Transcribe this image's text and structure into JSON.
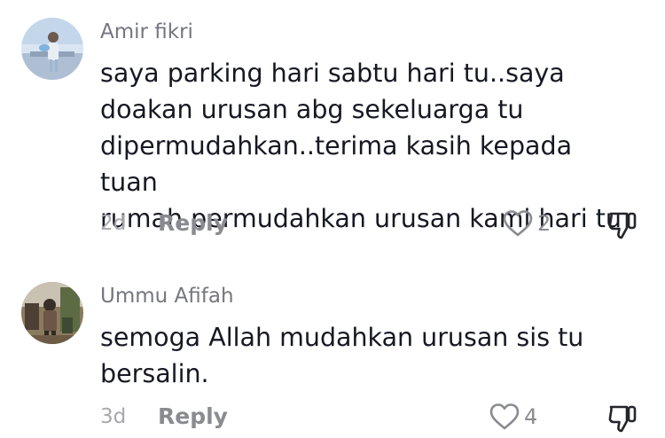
{
  "comments": [
    {
      "username": "Amir fikri",
      "lines": [
        "saya parking hari sabtu hari tu..saya",
        "doakan urusan abg sekeluarga tu",
        "dipermudahkan..terima kasih kepada tuan",
        "rumah permudahkan urusan kami hari tu"
      ],
      "time": "2d",
      "reply_label": "Reply",
      "likes": "2",
      "avatar_icon": "person-photo-avatar"
    },
    {
      "username": "Ummu Afifah",
      "lines": [
        "semoga Allah mudahkan urusan sis tu",
        "bersalin."
      ],
      "time": "3d",
      "reply_label": "Reply",
      "likes": "4",
      "avatar_icon": "person-photo-avatar"
    }
  ],
  "icons": {
    "like": "heart-outline-icon",
    "dislike": "thumbs-down-icon"
  },
  "colors": {
    "text": "#161823",
    "username": "#75767f",
    "meta": "#a7a8ad",
    "action": "#8a8b91"
  }
}
